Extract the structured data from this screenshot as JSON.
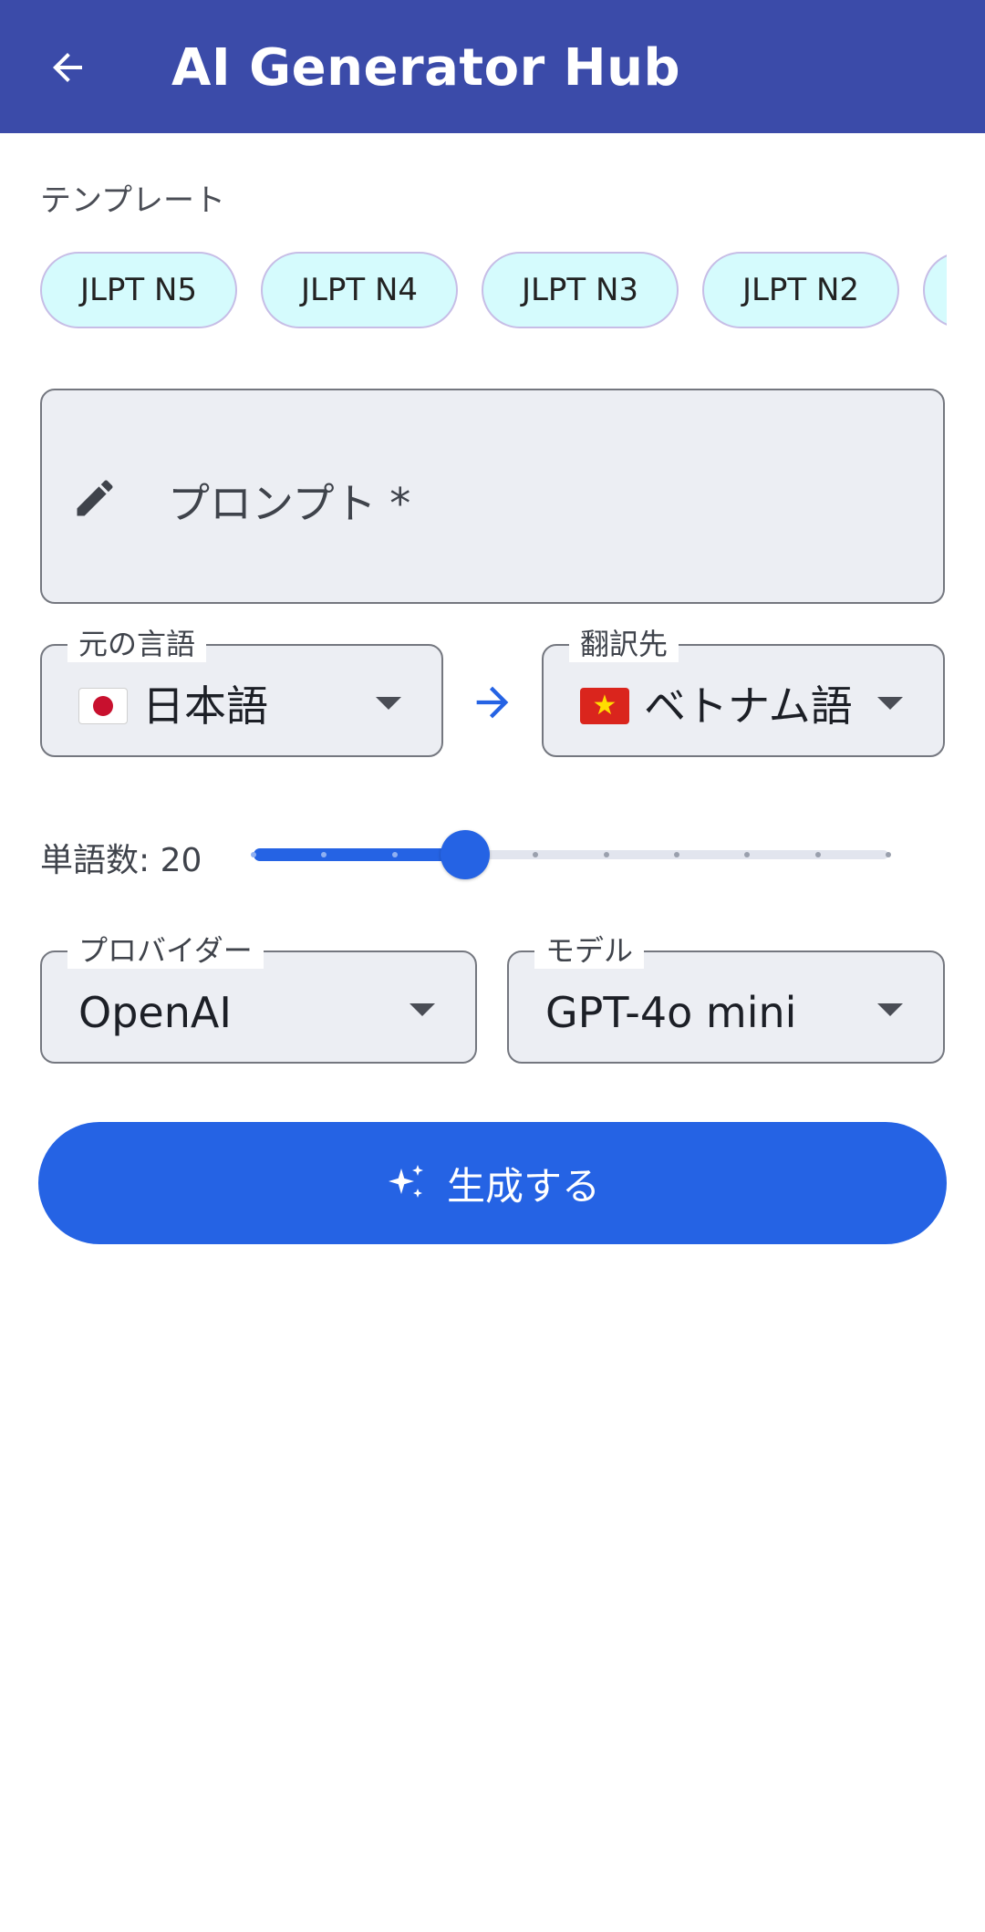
{
  "appbar": {
    "title": "AI Generator Hub"
  },
  "templates": {
    "label": "テンプレート",
    "chips": [
      "JLPT N5",
      "JLPT N4",
      "JLPT N3",
      "JLPT N2"
    ]
  },
  "prompt": {
    "label": "プロンプト *",
    "value": ""
  },
  "source_language": {
    "legend": "元の言語",
    "value": "日本語",
    "flag": "jp"
  },
  "target_language": {
    "legend": "翻訳先",
    "value": "ベトナム語",
    "flag": "vn"
  },
  "word_count": {
    "label": "単語数: 20",
    "value": 20,
    "min": 5,
    "max": 50,
    "step": 5
  },
  "provider": {
    "legend": "プロバイダー",
    "value": "OpenAI"
  },
  "model": {
    "legend": "モデル",
    "value": "GPT-4o mini"
  },
  "generate_button": {
    "label": "生成する"
  },
  "colors": {
    "appbar": "#3b4ba9",
    "primary": "#2563e4",
    "chip_bg": "#d5fbfd",
    "field_bg": "#eceef3"
  }
}
